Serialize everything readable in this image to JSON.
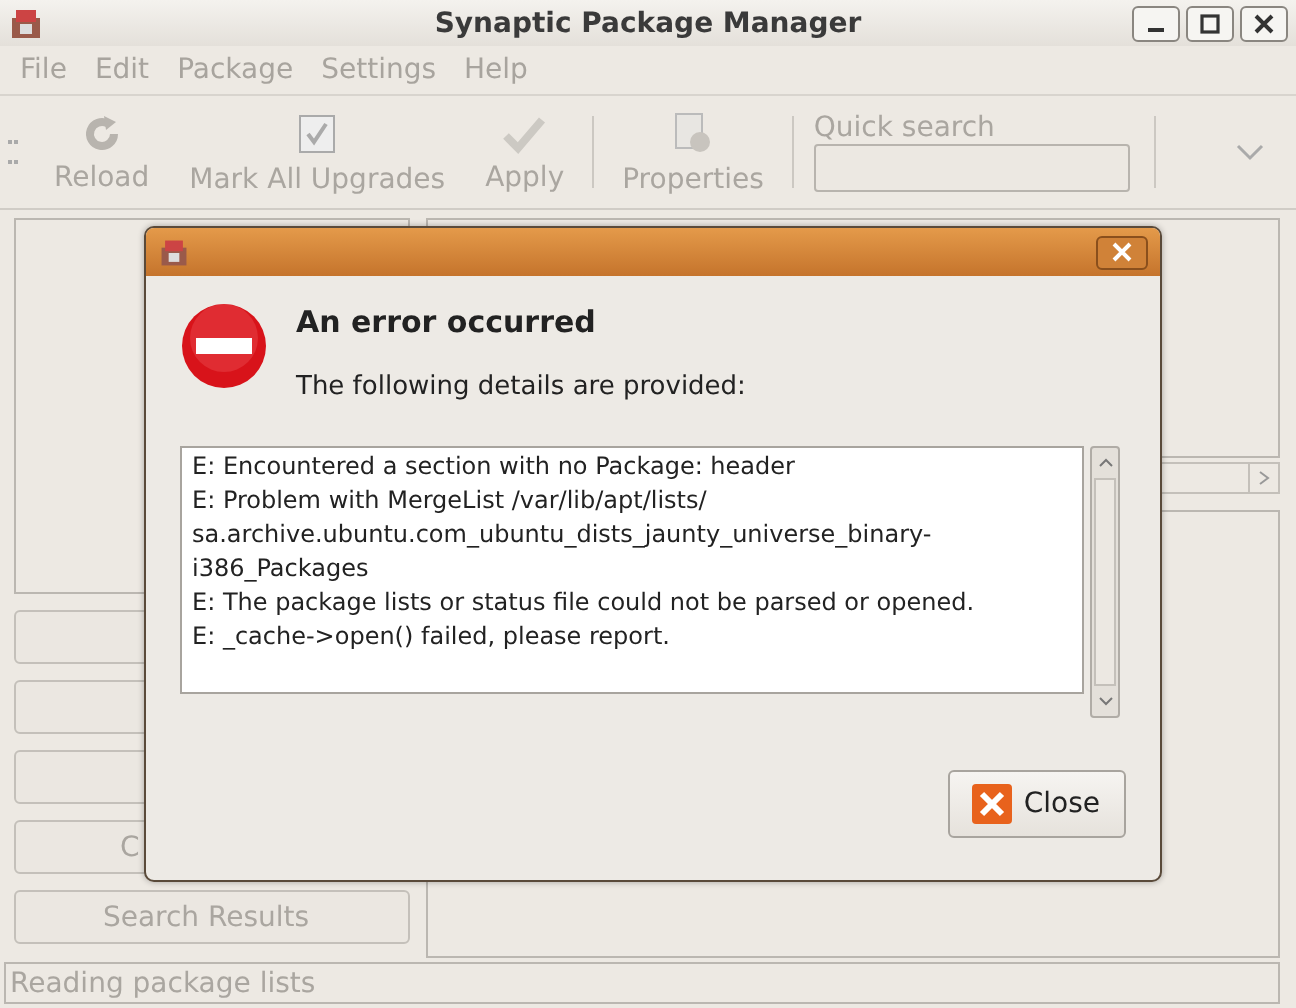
{
  "window": {
    "title": "Synaptic Package Manager"
  },
  "menu": [
    {
      "label": "File"
    },
    {
      "label": "Edit"
    },
    {
      "label": "Package"
    },
    {
      "label": "Settings"
    },
    {
      "label": "Help"
    }
  ],
  "toolbar": [
    {
      "kind": "button",
      "label": "Reload",
      "disabled": true
    },
    {
      "kind": "button",
      "label": "Mark All Upgrades",
      "disabled": true
    },
    {
      "kind": "button",
      "label": "Apply",
      "disabled": true
    },
    {
      "kind": "separator"
    },
    {
      "kind": "button",
      "label": "Properties",
      "disabled": true
    },
    {
      "kind": "separator"
    }
  ],
  "quick_search": {
    "label": "Quick search"
  },
  "sidebar": {
    "buttons": [
      {
        "disabled": true
      },
      {
        "disabled": true
      },
      {
        "disabled": true
      },
      {
        "label": "C",
        "disabled": true
      },
      {
        "label": "Search Results",
        "disabled": true
      }
    ]
  },
  "dialog": {
    "heading": "An error occurred",
    "subtitle": "The following details are provided:",
    "details": [
      "E: Encountered a section with no Package: header",
      "E: Problem with MergeList /var/lib/apt/lists/",
      "sa.archive.ubuntu.com_ubuntu_dists_jaunty_universe_binary-",
      "i386_Packages",
      "E: The package lists or status file could not be parsed or opened.",
      "E: _cache->open() failed, please report."
    ],
    "button": "Close"
  },
  "status_bar": "Reading package lists"
}
